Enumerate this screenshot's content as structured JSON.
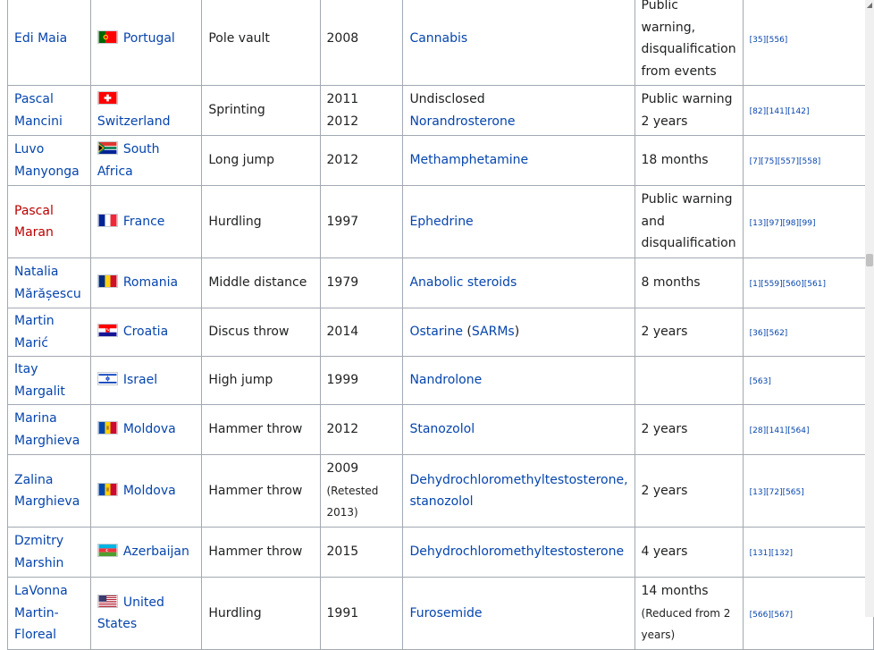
{
  "rows": [
    {
      "name": "Edi Maia",
      "name_style": "blue",
      "flag": "portugal-flag",
      "country": "Portugal",
      "sport": "Pole vault",
      "year": "2008",
      "year_note": "",
      "substance": "Cannabis",
      "substance_link": true,
      "substance_extra": "",
      "sanction": "Public warning, disqualification from events",
      "sanction_note": "",
      "refs": "[35][556]"
    },
    {
      "name": "Pascal Mancini",
      "name_style": "blue",
      "flag": "switzerland-flag",
      "country": "Switzerland",
      "sport": "Sprinting",
      "year": "2011",
      "year2": "2012",
      "year_note": "",
      "substance": "Undisclosed",
      "substance_link": false,
      "substance2": "Norandrosterone",
      "substance_extra": "",
      "sanction": "Public warning",
      "sanction2": "2 years",
      "sanction_note": "",
      "refs": "[82][141][142]"
    },
    {
      "name": "Luvo Manyonga",
      "name_style": "blue",
      "flag": "south-africa-flag",
      "country": "South Africa",
      "sport": "Long jump",
      "year": "2012",
      "year_note": "",
      "substance": "Methamphetamine",
      "substance_link": true,
      "substance_extra": "",
      "sanction": "18 months",
      "sanction_note": "",
      "refs": "[7][75][557][558]"
    },
    {
      "name": "Pascal Maran",
      "name_style": "red",
      "flag": "france-flag",
      "country": "France",
      "sport": "Hurdling",
      "year": "1997",
      "year_note": "",
      "substance": "Ephedrine",
      "substance_link": true,
      "substance_extra": "",
      "sanction": "Public warning and disqualification",
      "sanction_note": "",
      "refs": "[13][97][98][99]"
    },
    {
      "name": "Natalia Mărășescu",
      "name_style": "blue",
      "flag": "romania-flag",
      "country": "Romania",
      "sport": "Middle distance",
      "year": "1979",
      "year_note": "",
      "substance": "Anabolic steroids",
      "substance_link": true,
      "substance_extra": "",
      "sanction": "8 months",
      "sanction_note": "",
      "refs": "[1][559][560][561]"
    },
    {
      "name": "Martin Marić",
      "name_style": "blue",
      "flag": "croatia-flag",
      "country": "Croatia",
      "sport": "Discus throw",
      "year": "2014",
      "year_note": "",
      "substance": "Ostarine",
      "substance_link": true,
      "substance_extra": "SARMs",
      "sanction": "2 years",
      "sanction_note": "",
      "refs": "[36][562]"
    },
    {
      "name": "Itay Margalit",
      "name_style": "blue",
      "flag": "israel-flag",
      "country": "Israel",
      "sport": "High jump",
      "year": "1999",
      "year_note": "",
      "substance": "Nandrolone",
      "substance_link": true,
      "substance_extra": "",
      "sanction": "",
      "sanction_note": "",
      "refs": "[563]"
    },
    {
      "name": "Marina Marghieva",
      "name_style": "blue",
      "flag": "moldova-flag",
      "country": "Moldova",
      "sport": "Hammer throw",
      "year": "2012",
      "year_note": "",
      "substance": "Stanozolol",
      "substance_link": true,
      "substance_extra": "",
      "sanction": "2 years",
      "sanction_note": "",
      "refs": "[28][141][564]"
    },
    {
      "name": "Zalina Marghieva",
      "name_style": "blue",
      "flag": "moldova-flag",
      "country": "Moldova",
      "sport": "Hammer throw",
      "year": "2009",
      "year_note": "(Retested 2013)",
      "substance": "Dehydrochloromethyltestosterone, stanozolol",
      "substance_link": true,
      "substance_extra": "",
      "sanction": "2 years",
      "sanction_note": "",
      "refs": "[13][72][565]"
    },
    {
      "name": "Dzmitry Marshin",
      "name_style": "blue",
      "flag": "azerbaijan-flag",
      "country": "Azerbaijan",
      "sport": "Hammer throw",
      "year": "2015",
      "year_note": "",
      "substance": "Dehydrochloromethyltestosterone",
      "substance_link": true,
      "substance_extra": "",
      "sanction": "4 years",
      "sanction_note": "",
      "refs": "[131][132]"
    },
    {
      "name": "LaVonna Martin-Floreal",
      "name_style": "blue",
      "flag": "united-states-flag",
      "country": "United States",
      "sport": "Hurdling",
      "year": "1991",
      "year_note": "",
      "substance": "Furosemide",
      "substance_link": true,
      "substance_extra": "",
      "sanction": "14 months",
      "sanction_note": "(Reduced from 2 years)",
      "refs": "[566][567]"
    }
  ]
}
